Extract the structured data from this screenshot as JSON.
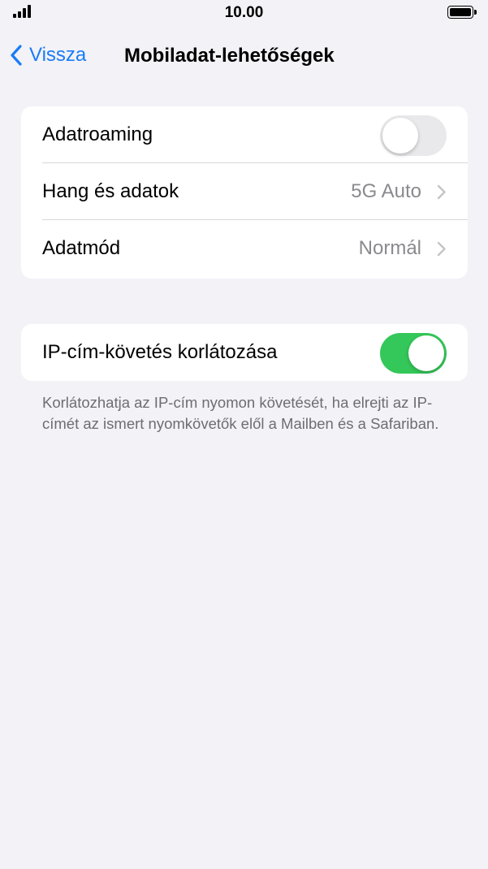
{
  "status_bar": {
    "time": "10.00"
  },
  "nav": {
    "back_label": "Vissza",
    "title": "Mobiladat-lehetőségek"
  },
  "groups": [
    {
      "rows": [
        {
          "label": "Adatroaming",
          "control": "toggle",
          "on": false
        },
        {
          "label": "Hang és adatok",
          "value": "5G Auto",
          "control": "chevron"
        },
        {
          "label": "Adatmód",
          "value": "Normál",
          "control": "chevron"
        }
      ]
    },
    {
      "rows": [
        {
          "label": "IP-cím-követés korlátozása",
          "control": "toggle",
          "on": true
        }
      ],
      "footer": "Korlátozhatja az IP-cím nyomon követését, ha elrejti az IP-címét az ismert nyomkövetők elől a Mailben és a Safariban."
    }
  ],
  "colors": {
    "accent": "#1a7cf5",
    "toggle_on": "#34c759",
    "toggle_off": "#e9e9eb",
    "background": "#f2f2f7"
  }
}
